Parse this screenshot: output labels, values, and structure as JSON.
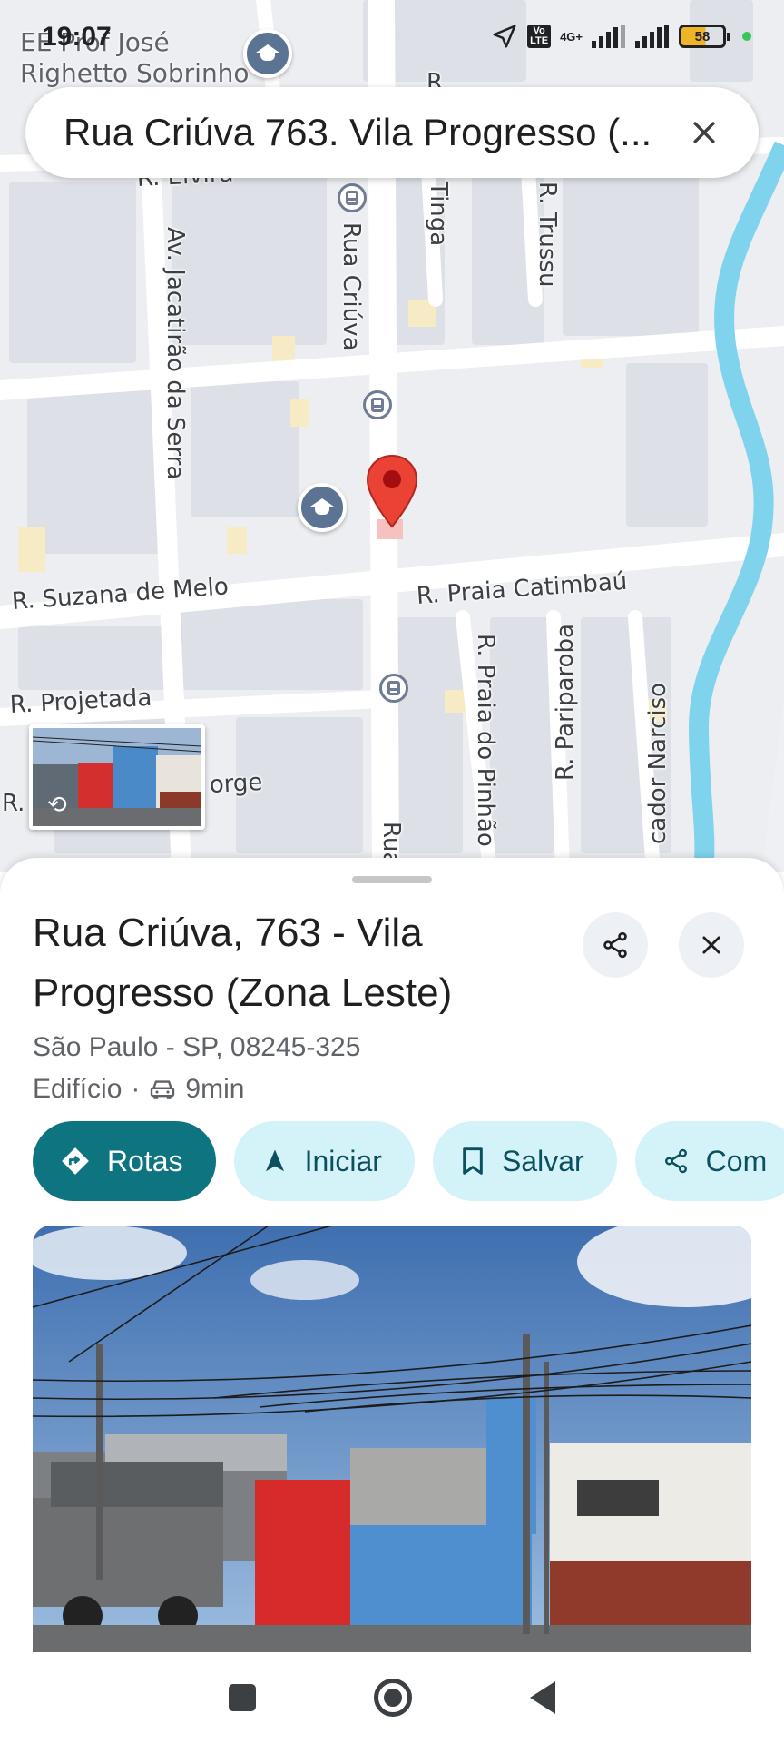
{
  "status_bar": {
    "time": "19:07",
    "network_label": "4G+",
    "volte_label": "Vo LTE",
    "battery_level": "58"
  },
  "search": {
    "query": "Rua Criúva 763. Vila Progresso (..."
  },
  "map": {
    "poi_label": "EE Prof José\nRighetto Sobrinho",
    "street_labels": {
      "elvira": "R. Elvira",
      "jacatirao": "Av. Jacatirão da Serra",
      "criuva": "Rua Criúva",
      "tinga": "Tinga",
      "trussu": "R. Trussu",
      "suzana": "R. Suzana de Melo",
      "praia_catimbau": "R. Praia Catimbaú",
      "projetada": "R. Projetada",
      "praia_pinhao": "R. Praia do Pinhão",
      "pariparoba": "R. Pariparoba",
      "narciso": "cador Narciso",
      "jorge": "orge",
      "r_short": "R.",
      "rua_bottom": "Rua",
      "r_top": "R"
    },
    "colors": {
      "river": "#7fd3ec",
      "pin": "#ea4335",
      "block": "#dde1e7",
      "road": "#ffffff"
    }
  },
  "place": {
    "title": "Rua Criúva, 763 - Vila Progresso (Zona Leste)",
    "address": "São Paulo - SP, 08245-325",
    "category": "Edifício",
    "separator": "·",
    "drive_time": "9min"
  },
  "actions": {
    "directions": "Rotas",
    "start": "Iniciar",
    "save": "Salvar",
    "share": "Com"
  },
  "icons": {
    "search_close": "close-icon",
    "share": "share-icon",
    "sheet_close": "close-icon",
    "directions": "directions-icon",
    "navigation": "navigation-arrow-icon",
    "bookmark": "bookmark-icon",
    "car": "car-icon"
  },
  "theme": {
    "primary": "#0e7580",
    "chip_bg": "#d3f3f9",
    "chip_text": "#0c4f5d"
  }
}
